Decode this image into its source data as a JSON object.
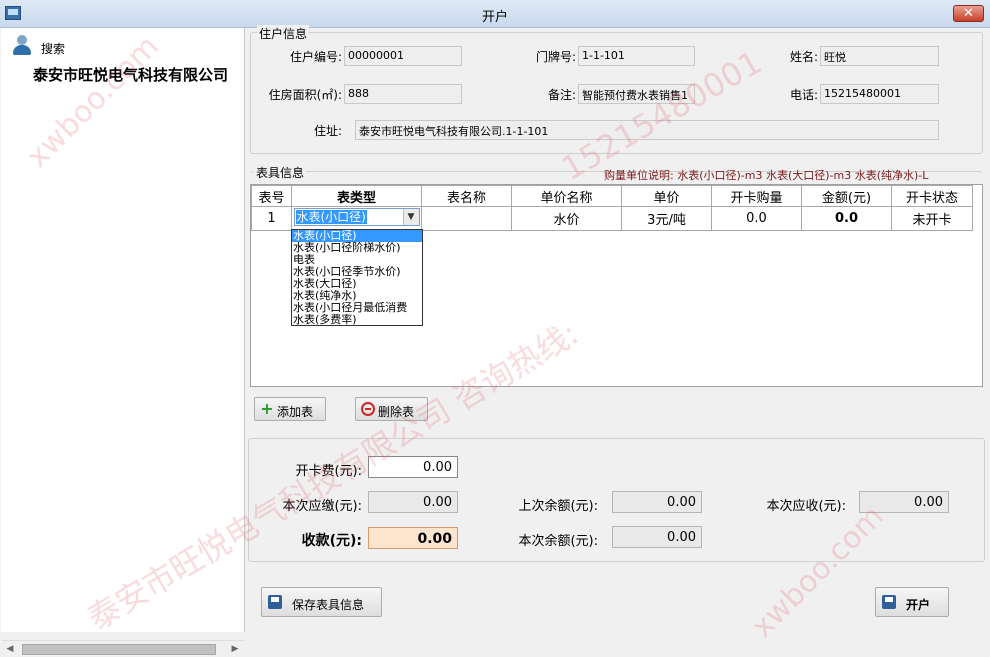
{
  "window": {
    "title": "开户",
    "close_glyph": "✕"
  },
  "sidebar": {
    "search_label": "搜索",
    "company_name": "泰安市旺悦电气科技有限公司"
  },
  "resident": {
    "group_title": "住户信息",
    "id_label": "住户编号:",
    "id_value": "00000001",
    "door_label": "门牌号:",
    "door_value": "1-1-101",
    "name_label": "姓名:",
    "name_value": "旺悦",
    "area_label": "住房面积(㎡):",
    "area_value": "888",
    "remark_label": "备注:",
    "remark_value": "智能预付费水表销售1",
    "phone_label": "电话:",
    "phone_value": "15215480001",
    "address_label": "住址:",
    "address_value": "泰安市旺悦电气科技有限公司.1-1-101"
  },
  "meters": {
    "group_title": "表具信息",
    "unit_note": "购量单位说明: 水表(小口径)-m3   水表(大口径)-m3   水表(纯净水)-L",
    "columns": [
      "表号",
      "表类型",
      "表名称",
      "单价名称",
      "单价",
      "开卡购量",
      "金额(元)",
      "开卡状态"
    ],
    "rows": [
      {
        "no": "1",
        "type": "水表(小口径)",
        "name": "",
        "price_name": "水价",
        "price": "3元/吨",
        "qty": "0.0",
        "amount": "0.0",
        "status": "未开卡"
      }
    ],
    "type_options": [
      "水表(小口径)",
      "水表(小口径阶梯水价)",
      "电表",
      "水表(小口径季节水价)",
      "水表(大口径)",
      "水表(纯净水)",
      "水表(小口径月最低消费",
      "水表(多费率)"
    ],
    "add_button": "添加表",
    "delete_button": "删除表"
  },
  "payment": {
    "card_fee_label": "开卡费(元):",
    "card_fee_value": "0.00",
    "due_label": "本次应缴(元):",
    "due_value": "0.00",
    "last_balance_label": "上次余额(元):",
    "last_balance_value": "0.00",
    "receivable_label": "本次应收(元):",
    "receivable_value": "0.00",
    "received_label": "收款(元):",
    "received_value": "0.00",
    "balance_label": "本次余额(元):",
    "balance_value": "0.00"
  },
  "footer": {
    "save_button": "保存表具信息",
    "open_button": "开户"
  },
  "watermarks": [
    "xwboo.com",
    "15215480001",
    "泰安市旺悦电气科技有限公司 咨询热线:",
    "xwboo.com"
  ],
  "colors": {
    "accent_select": "#3399ff",
    "received_bg": "#fce4cf",
    "note_text": "#7a1a1a",
    "watermark": "#e05a6e"
  }
}
